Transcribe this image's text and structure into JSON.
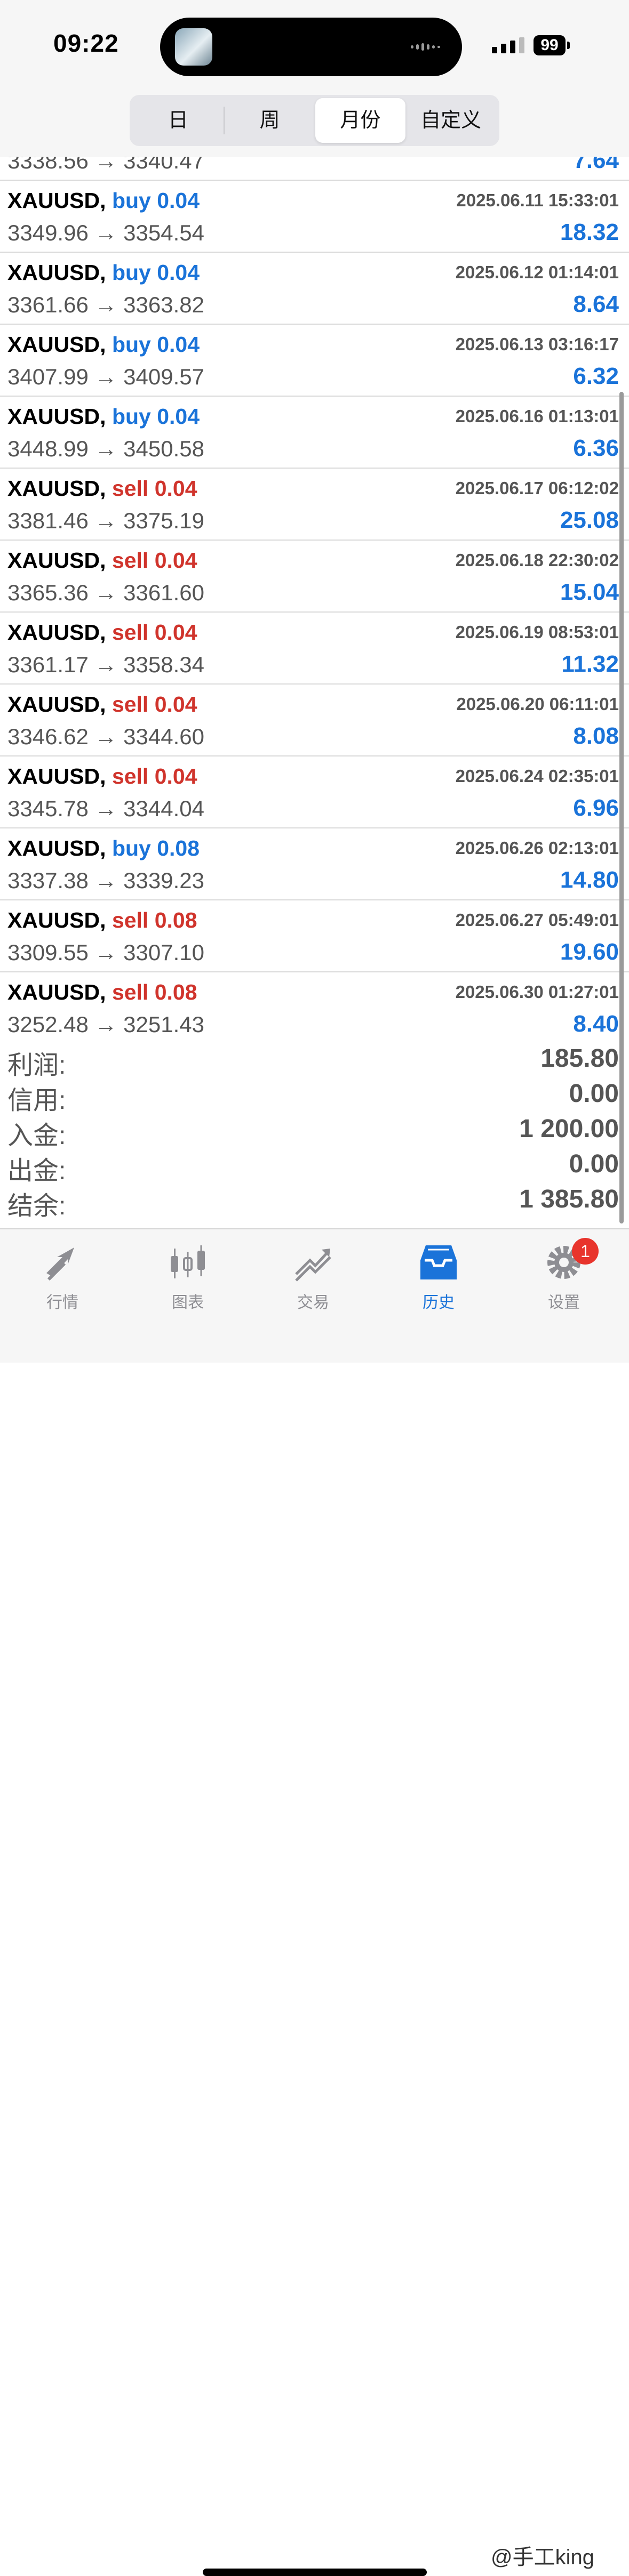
{
  "status_bar": {
    "time": "09:22",
    "battery": "99"
  },
  "period_tabs": [
    {
      "label": "日",
      "active": false
    },
    {
      "label": "周",
      "active": false
    },
    {
      "label": "月份",
      "active": true
    },
    {
      "label": "自定义",
      "active": false
    }
  ],
  "partial_row": {
    "prices": "3338.56 → 3340.47",
    "profit": "7.64"
  },
  "trades": [
    {
      "symbol": "XAUUSD,",
      "side": "buy",
      "volume": "buy 0.04",
      "time": "2025.06.11 15:33:01",
      "prices": "3349.96 → 3354.54",
      "profit": "18.32"
    },
    {
      "symbol": "XAUUSD,",
      "side": "buy",
      "volume": "buy 0.04",
      "time": "2025.06.12 01:14:01",
      "prices": "3361.66 → 3363.82",
      "profit": "8.64"
    },
    {
      "symbol": "XAUUSD,",
      "side": "buy",
      "volume": "buy 0.04",
      "time": "2025.06.13 03:16:17",
      "prices": "3407.99 → 3409.57",
      "profit": "6.32"
    },
    {
      "symbol": "XAUUSD,",
      "side": "buy",
      "volume": "buy 0.04",
      "time": "2025.06.16 01:13:01",
      "prices": "3448.99 → 3450.58",
      "profit": "6.36"
    },
    {
      "symbol": "XAUUSD,",
      "side": "sell",
      "volume": "sell 0.04",
      "time": "2025.06.17 06:12:02",
      "prices": "3381.46 → 3375.19",
      "profit": "25.08"
    },
    {
      "symbol": "XAUUSD,",
      "side": "sell",
      "volume": "sell 0.04",
      "time": "2025.06.18 22:30:02",
      "prices": "3365.36 → 3361.60",
      "profit": "15.04"
    },
    {
      "symbol": "XAUUSD,",
      "side": "sell",
      "volume": "sell 0.04",
      "time": "2025.06.19 08:53:01",
      "prices": "3361.17 → 3358.34",
      "profit": "11.32"
    },
    {
      "symbol": "XAUUSD,",
      "side": "sell",
      "volume": "sell 0.04",
      "time": "2025.06.20 06:11:01",
      "prices": "3346.62 → 3344.60",
      "profit": "8.08"
    },
    {
      "symbol": "XAUUSD,",
      "side": "sell",
      "volume": "sell 0.04",
      "time": "2025.06.24 02:35:01",
      "prices": "3345.78 → 3344.04",
      "profit": "6.96"
    },
    {
      "symbol": "XAUUSD,",
      "side": "buy",
      "volume": "buy 0.08",
      "time": "2025.06.26 02:13:01",
      "prices": "3337.38 → 3339.23",
      "profit": "14.80"
    },
    {
      "symbol": "XAUUSD,",
      "side": "sell",
      "volume": "sell 0.08",
      "time": "2025.06.27 05:49:01",
      "prices": "3309.55 → 3307.10",
      "profit": "19.60"
    },
    {
      "symbol": "XAUUSD,",
      "side": "sell",
      "volume": "sell 0.08",
      "time": "2025.06.30 01:27:01",
      "prices": "3252.48 → 3251.43",
      "profit": "8.40"
    }
  ],
  "summary": [
    {
      "label": "利润:",
      "value": "185.80"
    },
    {
      "label": "信用:",
      "value": "0.00"
    },
    {
      "label": "入金:",
      "value": "1 200.00"
    },
    {
      "label": "出金:",
      "value": "0.00"
    },
    {
      "label": "结余:",
      "value": "1 385.80"
    }
  ],
  "tabbar": {
    "items": [
      {
        "label": "行情",
        "icon": "quotes-icon",
        "active": false
      },
      {
        "label": "图表",
        "icon": "chart-icon",
        "active": false
      },
      {
        "label": "交易",
        "icon": "trade-icon",
        "active": false
      },
      {
        "label": "历史",
        "icon": "history-icon",
        "active": true
      },
      {
        "label": "设置",
        "icon": "settings-icon",
        "active": false
      }
    ],
    "settings_badge": "1"
  },
  "watermark": "@手工king",
  "colors": {
    "buy": "#1a73d9",
    "sell": "#d0342c",
    "profit": "#1a73d9",
    "active_tab": "#1a73d9"
  }
}
